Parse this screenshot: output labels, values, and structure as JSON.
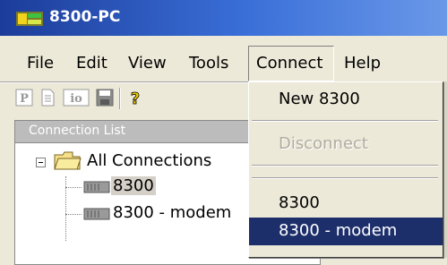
{
  "window": {
    "title": "8300-PC",
    "icon": "app-icon"
  },
  "menubar": {
    "items": [
      {
        "label": "File"
      },
      {
        "label": "Edit"
      },
      {
        "label": "View"
      },
      {
        "label": "Tools"
      },
      {
        "label": "Connect",
        "open": true
      },
      {
        "label": "Help"
      }
    ]
  },
  "toolbar": {
    "buttons": [
      {
        "icon": "p-icon",
        "label": "P"
      },
      {
        "icon": "document-icon"
      },
      {
        "icon": "io-icon",
        "label": "io"
      },
      {
        "icon": "save-icon"
      },
      {
        "icon": "help-icon",
        "label": "?"
      }
    ]
  },
  "connection_list": {
    "title": "Connection List",
    "root": {
      "label": "All Connections",
      "expanded": true
    },
    "children": [
      {
        "label": "8300",
        "selected": true
      },
      {
        "label": "8300 - modem"
      }
    ]
  },
  "connect_menu": {
    "items": [
      {
        "label": "New 8300",
        "enabled": true
      },
      {
        "label": "Disconnect",
        "enabled": false
      },
      {
        "label": "8300",
        "enabled": true
      },
      {
        "label": "8300 - modem",
        "enabled": true,
        "highlighted": true
      }
    ]
  },
  "colors": {
    "title_gradient_start": "#1c3c99",
    "title_gradient_end": "#6a98e8",
    "menu_highlight": "#1d2f6b",
    "window_bg": "#ece9d8"
  }
}
